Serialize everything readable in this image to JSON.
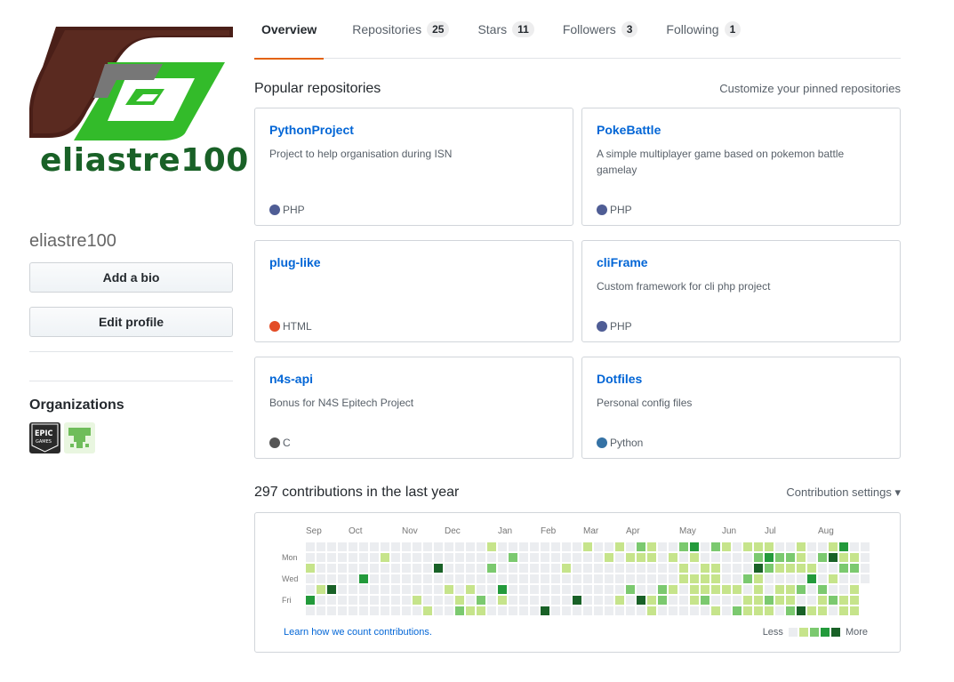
{
  "profile": {
    "avatar_text": "eliastre100",
    "username": "eliastre100",
    "add_bio_label": "Add a bio",
    "edit_profile_label": "Edit profile",
    "organizations_title": "Organizations",
    "org_epic_text": "EPIC",
    "org_epic_subtext": "GAMES"
  },
  "tabs": [
    {
      "label": "Overview",
      "count": ""
    },
    {
      "label": "Repositories",
      "count": "25"
    },
    {
      "label": "Stars",
      "count": "11"
    },
    {
      "label": "Followers",
      "count": "3"
    },
    {
      "label": "Following",
      "count": "1"
    }
  ],
  "popular": {
    "title": "Popular repositories",
    "customize_label": "Customize your pinned repositories",
    "repos": [
      {
        "name": "PythonProject",
        "desc": "Project to help organisation during ISN",
        "lang": "PHP",
        "color": "#4F5D95"
      },
      {
        "name": "PokeBattle",
        "desc": "A simple multiplayer game based on pokemon battle gamelay",
        "lang": "PHP",
        "color": "#4F5D95"
      },
      {
        "name": "plug-like",
        "desc": "",
        "lang": "HTML",
        "color": "#e34c26"
      },
      {
        "name": "cliFrame",
        "desc": "Custom framework for cli php project",
        "lang": "PHP",
        "color": "#4F5D95"
      },
      {
        "name": "n4s-api",
        "desc": "Bonus for N4S Epitech Project",
        "lang": "C",
        "color": "#555555"
      },
      {
        "name": "Dotfiles",
        "desc": "Personal config files",
        "lang": "Python",
        "color": "#3572A5"
      }
    ]
  },
  "contributions": {
    "title": "297 contributions in the last year",
    "settings_label": "Contribution settings ▾",
    "months": [
      "Sep",
      "Oct",
      "Nov",
      "Dec",
      "Jan",
      "Feb",
      "Mar",
      "Apr",
      "May",
      "Jun",
      "Jul",
      "Aug"
    ],
    "days": [
      "Mon",
      "Wed",
      "Fri"
    ],
    "learn_label": "Learn how we count contributions.",
    "legend_less": "Less",
    "legend_more": "More",
    "colors": [
      "#ebedf0",
      "#c6e48b",
      "#7bc96f",
      "#239a3b",
      "#196127"
    ]
  }
}
